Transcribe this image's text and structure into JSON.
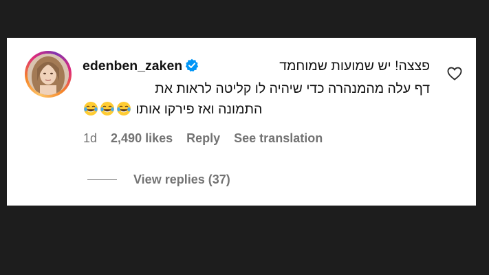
{
  "comment": {
    "username": "edenben_zaken",
    "line1": "פצצה! יש שמועות שמוחמד",
    "line2": "דף עלה מהמנהרה כדי שיהיה לו קליטה לראות את",
    "line3": "התמונה ואז פירקו אותו",
    "emoji": "face-with-tears-of-joy",
    "emoji_count": 3
  },
  "meta": {
    "age": "1d",
    "likes": "2,490 likes",
    "reply": "Reply",
    "translate": "See translation"
  },
  "replies": {
    "label": "View replies (37)"
  },
  "colors": {
    "background": "#1d1d1d",
    "card": "#ffffff",
    "verified": "#0095f6",
    "muted": "#737373"
  }
}
